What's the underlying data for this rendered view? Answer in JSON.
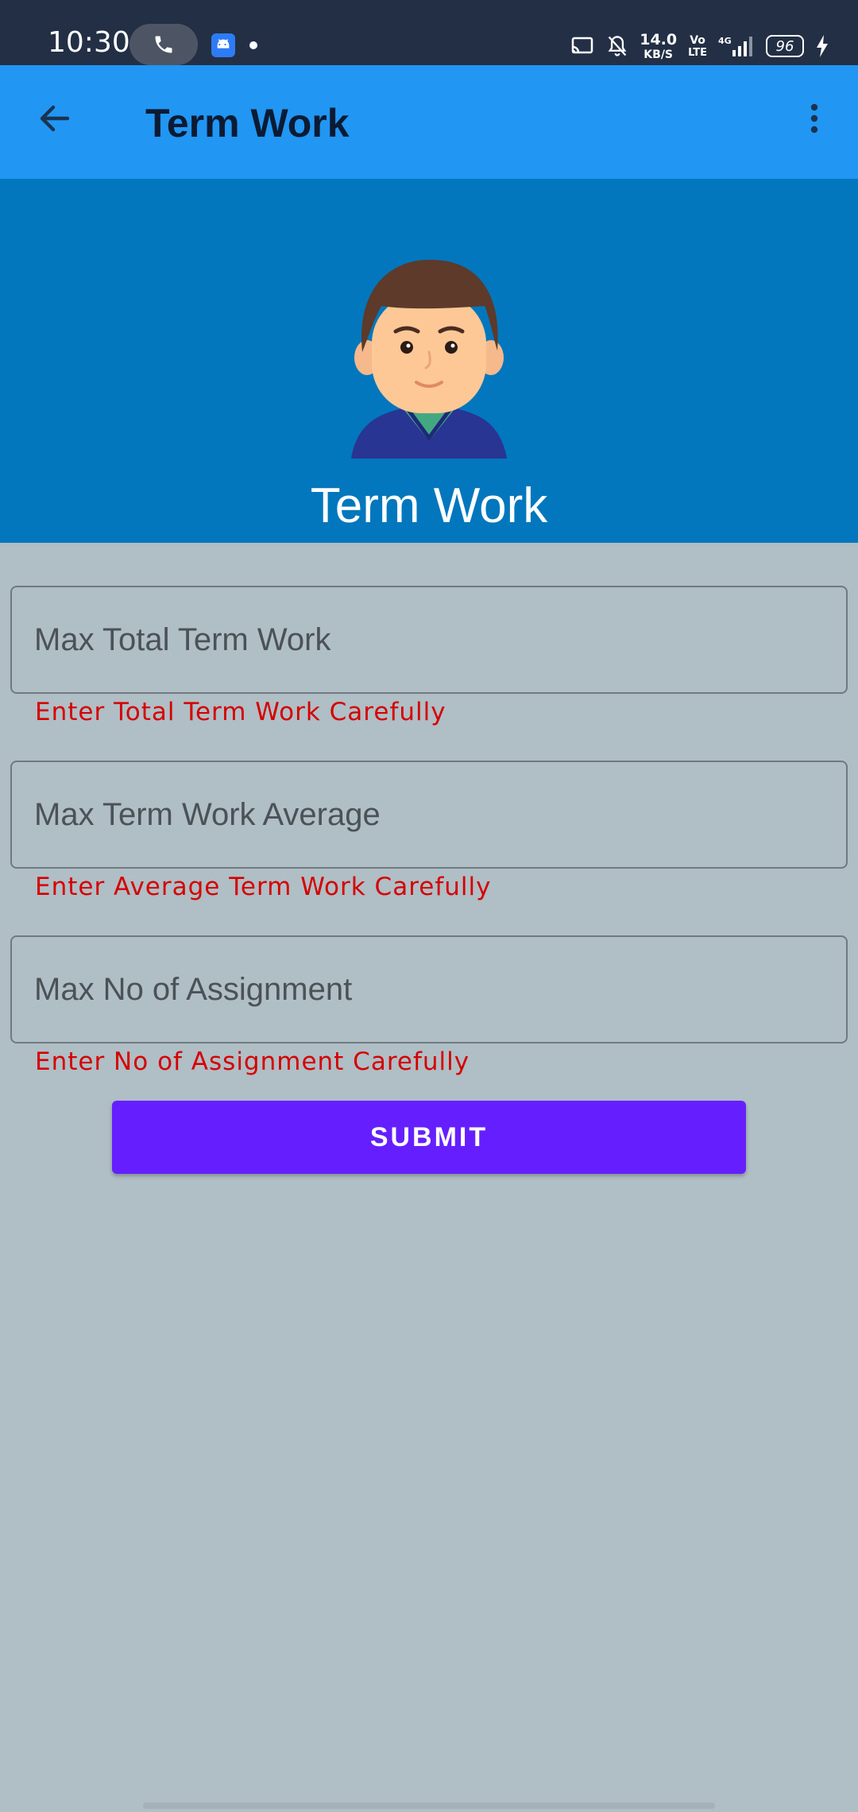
{
  "status_bar": {
    "time": "10:30",
    "net_speed_value": "14.0",
    "net_speed_unit": "KB/S",
    "volte_top": "Vo",
    "volte_bottom": "LTE",
    "network_type": "4G",
    "battery": "96"
  },
  "app_bar": {
    "title": "Term Work"
  },
  "banner": {
    "title": "Term Work"
  },
  "form": {
    "fields": [
      {
        "placeholder": "Max Total Term Work",
        "value": "",
        "error": "Enter Total Term Work Carefully"
      },
      {
        "placeholder": "Max Term Work Average",
        "value": "",
        "error": "Enter Average Term Work Carefully"
      },
      {
        "placeholder": "Max No of Assignment",
        "value": "",
        "error": "Enter No of Assignment Carefully"
      }
    ],
    "submit_label": "SUBMIT"
  },
  "colors": {
    "status_bar": "#232f45",
    "app_bar": "#2196f3",
    "banner": "#0277bd",
    "background": "#b0bec5",
    "error": "#d50000",
    "submit": "#651fff"
  },
  "icons": {
    "back": "arrow-left",
    "more": "more-vertical",
    "call": "phone",
    "avatar": "boy-avatar"
  }
}
